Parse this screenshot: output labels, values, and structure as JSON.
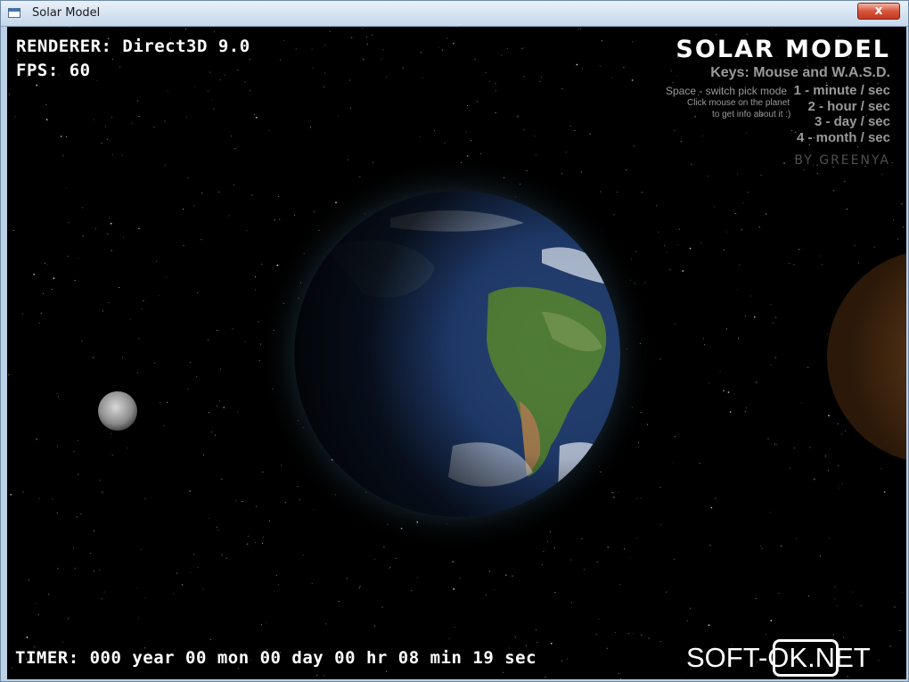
{
  "window": {
    "title": "Solar Model",
    "close_label": "x"
  },
  "hud": {
    "renderer": "RENDERER: Direct3D 9.0",
    "fps": "FPS: 60",
    "timer": "TIMER: 000 year 00 mon 00 day 00 hr 08 min 19 sec"
  },
  "info_panel": {
    "logo": "SOLAR MODEL",
    "keys": "Keys:  Mouse and W.A.S.D.",
    "space_hint": "Space - switch pick mode",
    "click_hint_1": "Click mouse on the planet",
    "click_hint_2": "to get info about it :)",
    "speed_1": "1 - minute / sec",
    "speed_2": "2 - hour / sec",
    "speed_3": "3 - day / sec",
    "speed_4": "4 - month / sec",
    "byline": "BY GREENYA"
  },
  "watermark": "SOFT-OK.NET",
  "colors": {
    "background": "#000000",
    "hud_text": "#ffffff",
    "help_text": "#9a9a9a",
    "titlebar": "#d4e2f1",
    "close_button": "#d8553b"
  }
}
